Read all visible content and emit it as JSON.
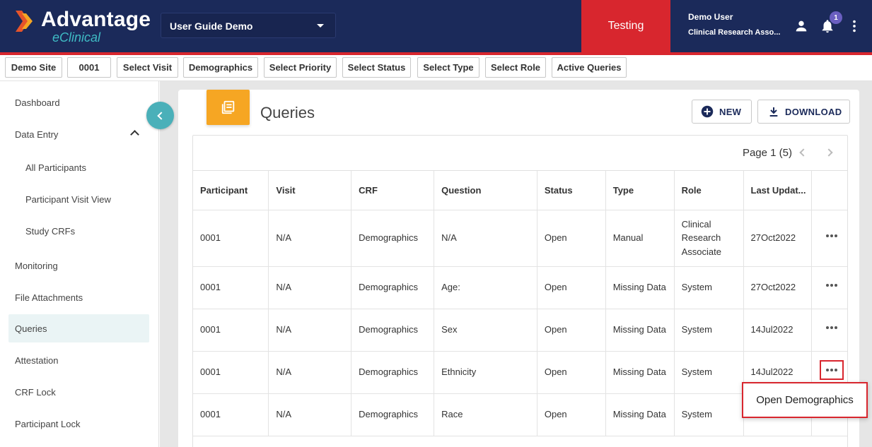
{
  "header": {
    "logo_title": "Advantage",
    "logo_subtitle": "eClinical",
    "study_select": "User Guide Demo",
    "environment": "Testing",
    "user_name": "Demo User",
    "user_role": "Clinical Research Asso...",
    "notification_count": "1",
    "icons": [
      "user-icon",
      "bell-icon",
      "more-vertical-icon"
    ],
    "colors": {
      "header_bg": "#1b2a5a",
      "environment_bg": "#d8262e",
      "accent_teal": "#4ab0b9",
      "card_icon": "#f6a623"
    }
  },
  "filters": [
    "Demo Site",
    "0001",
    "Select Visit",
    "Demographics",
    "Select Priority",
    "Select Status",
    "Select Type",
    "Select Role",
    "Active Queries"
  ],
  "sidebar": {
    "items": [
      {
        "label": "Dashboard"
      },
      {
        "label": "Data Entry",
        "expanded": true
      },
      {
        "label": "All Participants"
      },
      {
        "label": "Participant Visit View"
      },
      {
        "label": "Study CRFs"
      },
      {
        "label": "Monitoring"
      },
      {
        "label": "File Attachments"
      },
      {
        "label": "Queries",
        "active": true
      },
      {
        "label": "Attestation"
      },
      {
        "label": "CRF Lock"
      },
      {
        "label": "Participant Lock"
      }
    ]
  },
  "main": {
    "title": "Queries",
    "new_label": "NEW",
    "download_label": "DOWNLOAD",
    "pager_label": "Page 1 (5)",
    "columns": [
      "Participant",
      "Visit",
      "CRF",
      "Question",
      "Status",
      "Type",
      "Role",
      "Last Updat..."
    ],
    "rows": [
      [
        "0001",
        "N/A",
        "Demographics",
        "N/A",
        "Open",
        "Manual",
        "Clinical Research Associate",
        "27Oct2022"
      ],
      [
        "0001",
        "N/A",
        "Demographics",
        "Age:",
        "Open",
        "Missing Data",
        "System",
        "27Oct2022"
      ],
      [
        "0001",
        "N/A",
        "Demographics",
        "Sex",
        "Open",
        "Missing Data",
        "System",
        "14Jul2022"
      ],
      [
        "0001",
        "N/A",
        "Demographics",
        "Ethnicity",
        "Open",
        "Missing Data",
        "System",
        "14Jul2022"
      ],
      [
        "0001",
        "N/A",
        "Demographics",
        "Race",
        "Open",
        "Missing Data",
        "System",
        ""
      ]
    ],
    "row_menu_item": "Open Demographics"
  }
}
